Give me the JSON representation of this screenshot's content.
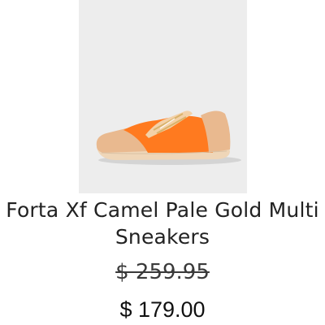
{
  "product": {
    "name": "Forta Xf Camel Pale Gold Multi Sneakers",
    "original_price": "$ 259.95",
    "sale_price": "$ 179.00",
    "image": {
      "icon": "sneaker-image",
      "colors": {
        "background": "#ededed",
        "upper": "#ff7a1f",
        "toe_heel": "#e9b98f",
        "sole": "#efd6b8",
        "zip": "#d9b26a"
      }
    }
  }
}
